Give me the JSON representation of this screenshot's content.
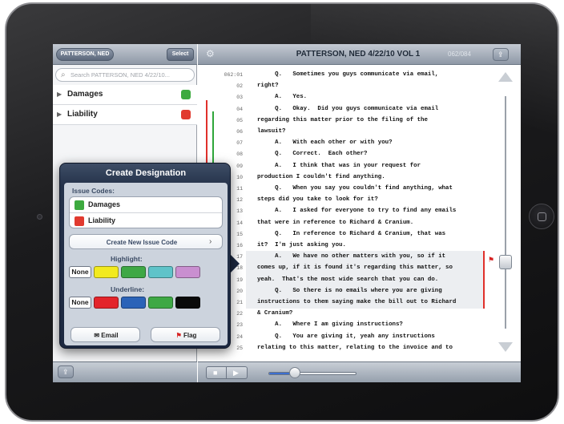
{
  "left_pane": {
    "deponent_button": "PATTERSON, NED",
    "select_button": "Select",
    "search_placeholder": "Search PATTERSON, NED 4/22/10...",
    "issues": [
      {
        "label": "Damages",
        "color": "#3daa3f"
      },
      {
        "label": "Liability",
        "color": "#e13a2f"
      }
    ]
  },
  "header": {
    "title": "PATTERSON, NED 4/22/10 VOL 1",
    "page_indicator": "062/084"
  },
  "transcript": {
    "lines": [
      {
        "num": "062:01",
        "text": "     Q.   Sometimes you guys communicate via email,"
      },
      {
        "num": "02",
        "text": "right?"
      },
      {
        "num": "03",
        "text": "     A.   Yes."
      },
      {
        "num": "04",
        "text": "     Q.   Okay.  Did you guys communicate via email"
      },
      {
        "num": "05",
        "text": "regarding this matter prior to the filing of the"
      },
      {
        "num": "06",
        "text": "lawsuit?"
      },
      {
        "num": "07",
        "text": "     A.   With each other or with you?"
      },
      {
        "num": "08",
        "text": "     Q.   Correct.  Each other?"
      },
      {
        "num": "09",
        "text": "     A.   I think that was in your request for"
      },
      {
        "num": "10",
        "text": "production I couldn't find anything."
      },
      {
        "num": "11",
        "text": "     Q.   When you say you couldn't find anything, what"
      },
      {
        "num": "12",
        "text": "steps did you take to look for it?"
      },
      {
        "num": "13",
        "text": "     A.   I asked for everyone to try to find any emails"
      },
      {
        "num": "14",
        "text": "that were in reference to Richard & Cranium."
      },
      {
        "num": "15",
        "text": "     Q.   In reference to Richard & Cranium, that was"
      },
      {
        "num": "16",
        "text": "it?  I'm just asking you."
      },
      {
        "num": "17",
        "text": "     A.   We have no other matters with you, so if it"
      },
      {
        "num": "18",
        "text": "comes up, if it is found it's regarding this matter, so"
      },
      {
        "num": "19",
        "text": "yeah.  That's the most wide search that you can do."
      },
      {
        "num": "20",
        "text": "     Q.   So there is no emails where you are giving"
      },
      {
        "num": "21",
        "text": "instructions to them saying make the bill out to Richard"
      },
      {
        "num": "22",
        "text": "& Cranium?"
      },
      {
        "num": "23",
        "text": "     A.   Where I am giving instructions?"
      },
      {
        "num": "24",
        "text": "     Q.   You are giving it, yeah any instructions"
      },
      {
        "num": "25",
        "text": "relating to this matter, relating to the invoice and to"
      }
    ]
  },
  "popover": {
    "title": "Create Designation",
    "issue_codes_label": "Issue Codes:",
    "issue_codes": [
      {
        "label": "Damages",
        "color": "#3daa3f"
      },
      {
        "label": "Liability",
        "color": "#e13a2f"
      }
    ],
    "create_new_label": "Create New Issue Code",
    "highlight_label": "Highlight:",
    "highlight_none": "None",
    "highlight_colors": [
      "#f2ea1e",
      "#3ea845",
      "#5fc3c9",
      "#c98fd0"
    ],
    "underline_label": "Underline:",
    "underline_none": "None",
    "underline_colors": [
      "#e3242b",
      "#2b63b8",
      "#3ea845",
      "#0a0a0a"
    ],
    "email_label": "Email",
    "flag_label": "Flag"
  },
  "media": {
    "playback_progress": 0.3
  }
}
